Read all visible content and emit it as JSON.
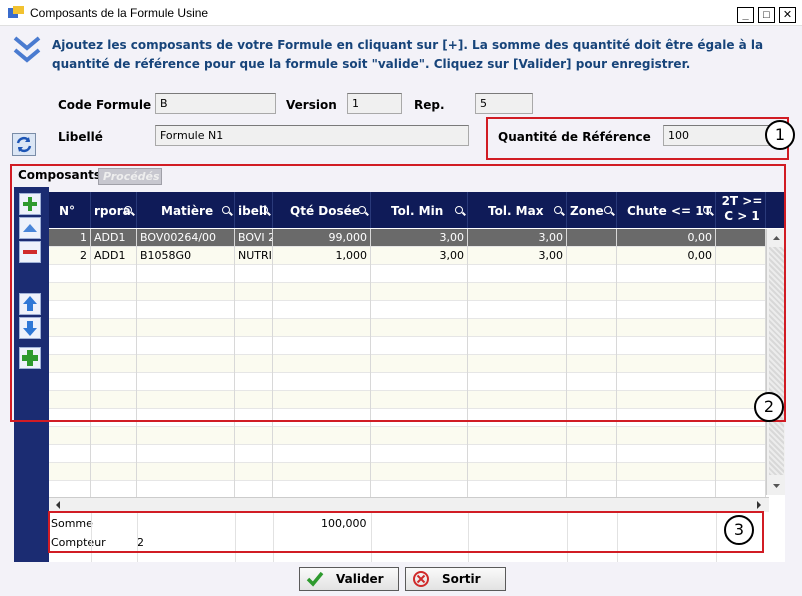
{
  "window": {
    "title": "Composants de la Formule Usine",
    "minimize_glyph": "_",
    "maximize_glyph": "□",
    "close_glyph": "✕"
  },
  "instructions": "Ajoutez les composants de votre Formule en cliquant sur [+]. La somme des quantité doit être égale à la quantité de référence pour que la formule soit \"valide\". Cliquez sur [Valider] pour enregistrer.",
  "form": {
    "code_label": "Code Formule",
    "code_value": "B",
    "version_label": "Version",
    "version_value": "1",
    "rep_label": "Rep.",
    "rep_value": "5",
    "libelle_label": "Libellé",
    "libelle_value": "Formule N1",
    "qref_label": "Quantité  de Référence",
    "qref_value": "100"
  },
  "tabs": [
    {
      "label": "Composants",
      "active": true
    },
    {
      "label": "Procédés",
      "active": false
    }
  ],
  "grid": {
    "columns": [
      "N°",
      "rpora",
      "Matière",
      "ibell",
      "Qté Dosée",
      "Tol. Min",
      "Tol. Max",
      "Zone",
      "Chute <= 1T",
      "2T >= C > 1"
    ],
    "rows": [
      [
        "1",
        "ADD1",
        "BOV00264/00",
        "BOVI 2",
        "99,000",
        "3,00",
        "3,00",
        "",
        "0,00",
        ""
      ],
      [
        "2",
        "ADD1",
        "B1058G0",
        "NUTRI",
        "1,000",
        "3,00",
        "3,00",
        "",
        "0,00",
        ""
      ]
    ],
    "total_rows": 15
  },
  "footer": {
    "somme_label": "Somme",
    "somme_value": "100,000",
    "compteur_label": "Compteur",
    "compteur_value": "2"
  },
  "buttons": {
    "valider": "Valider",
    "sortir": "Sortir"
  },
  "badges": [
    "1",
    "2",
    "3"
  ],
  "colors": {
    "grid_header": "#0f1b58",
    "toolbar": "#1b2c72",
    "highlight_frame": "#d11c24",
    "instruction_text": "#17447a"
  }
}
